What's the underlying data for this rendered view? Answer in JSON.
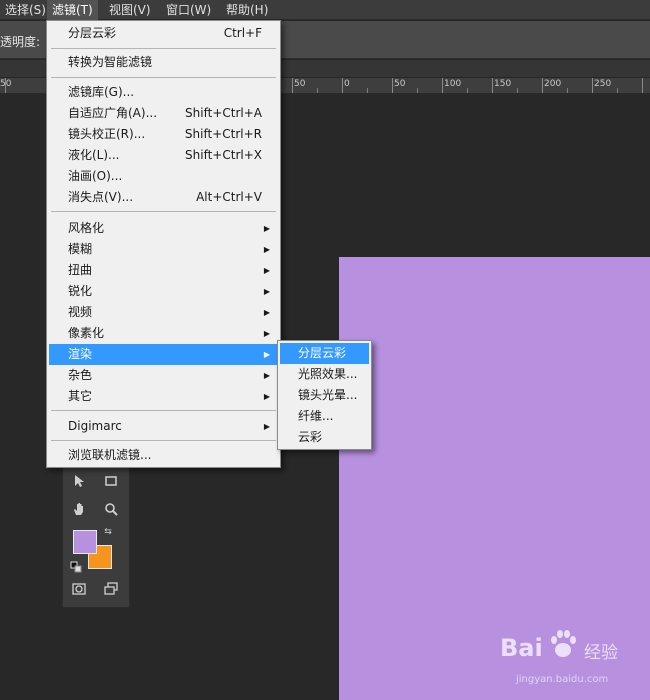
{
  "menubar": {
    "items": [
      "选择(S)",
      "滤镜(T)",
      "视图(V)",
      "窗口(W)",
      "帮助(H)"
    ]
  },
  "optionsbar": {
    "opacity_label": "透明度:"
  },
  "ruler": {
    "labels": [
      "50",
      "50",
      "0",
      "50",
      "100",
      "150",
      "200",
      "250"
    ]
  },
  "filter_menu": {
    "items": [
      {
        "label": "分层云彩",
        "shortcut": "Ctrl+F"
      },
      {
        "label": "转换为智能滤镜"
      },
      {
        "label": "滤镜库(G)..."
      },
      {
        "label": "自适应广角(A)...",
        "shortcut": "Shift+Ctrl+A"
      },
      {
        "label": "镜头校正(R)...",
        "shortcut": "Shift+Ctrl+R"
      },
      {
        "label": "液化(L)...",
        "shortcut": "Shift+Ctrl+X"
      },
      {
        "label": "油画(O)..."
      },
      {
        "label": "消失点(V)...",
        "shortcut": "Alt+Ctrl+V"
      },
      {
        "label": "风格化"
      },
      {
        "label": "模糊"
      },
      {
        "label": "扭曲"
      },
      {
        "label": "锐化"
      },
      {
        "label": "视频"
      },
      {
        "label": "像素化"
      },
      {
        "label": "渲染"
      },
      {
        "label": "杂色"
      },
      {
        "label": "其它"
      },
      {
        "label": "Digimarc"
      },
      {
        "label": "浏览联机滤镜..."
      }
    ],
    "highlighted": "渲染"
  },
  "render_submenu": {
    "items": [
      "分层云彩",
      "光照效果...",
      "镜头光晕...",
      "纤维...",
      "云彩"
    ],
    "highlighted": "分层云彩"
  },
  "colors": {
    "foreground": "#b890e0",
    "background": "#f7941d",
    "canvas": "#b890e0",
    "highlight": "#3399ff"
  },
  "watermark": {
    "logo": "Bai",
    "logo2": "经验",
    "url": "jingyan.baidu.com"
  }
}
